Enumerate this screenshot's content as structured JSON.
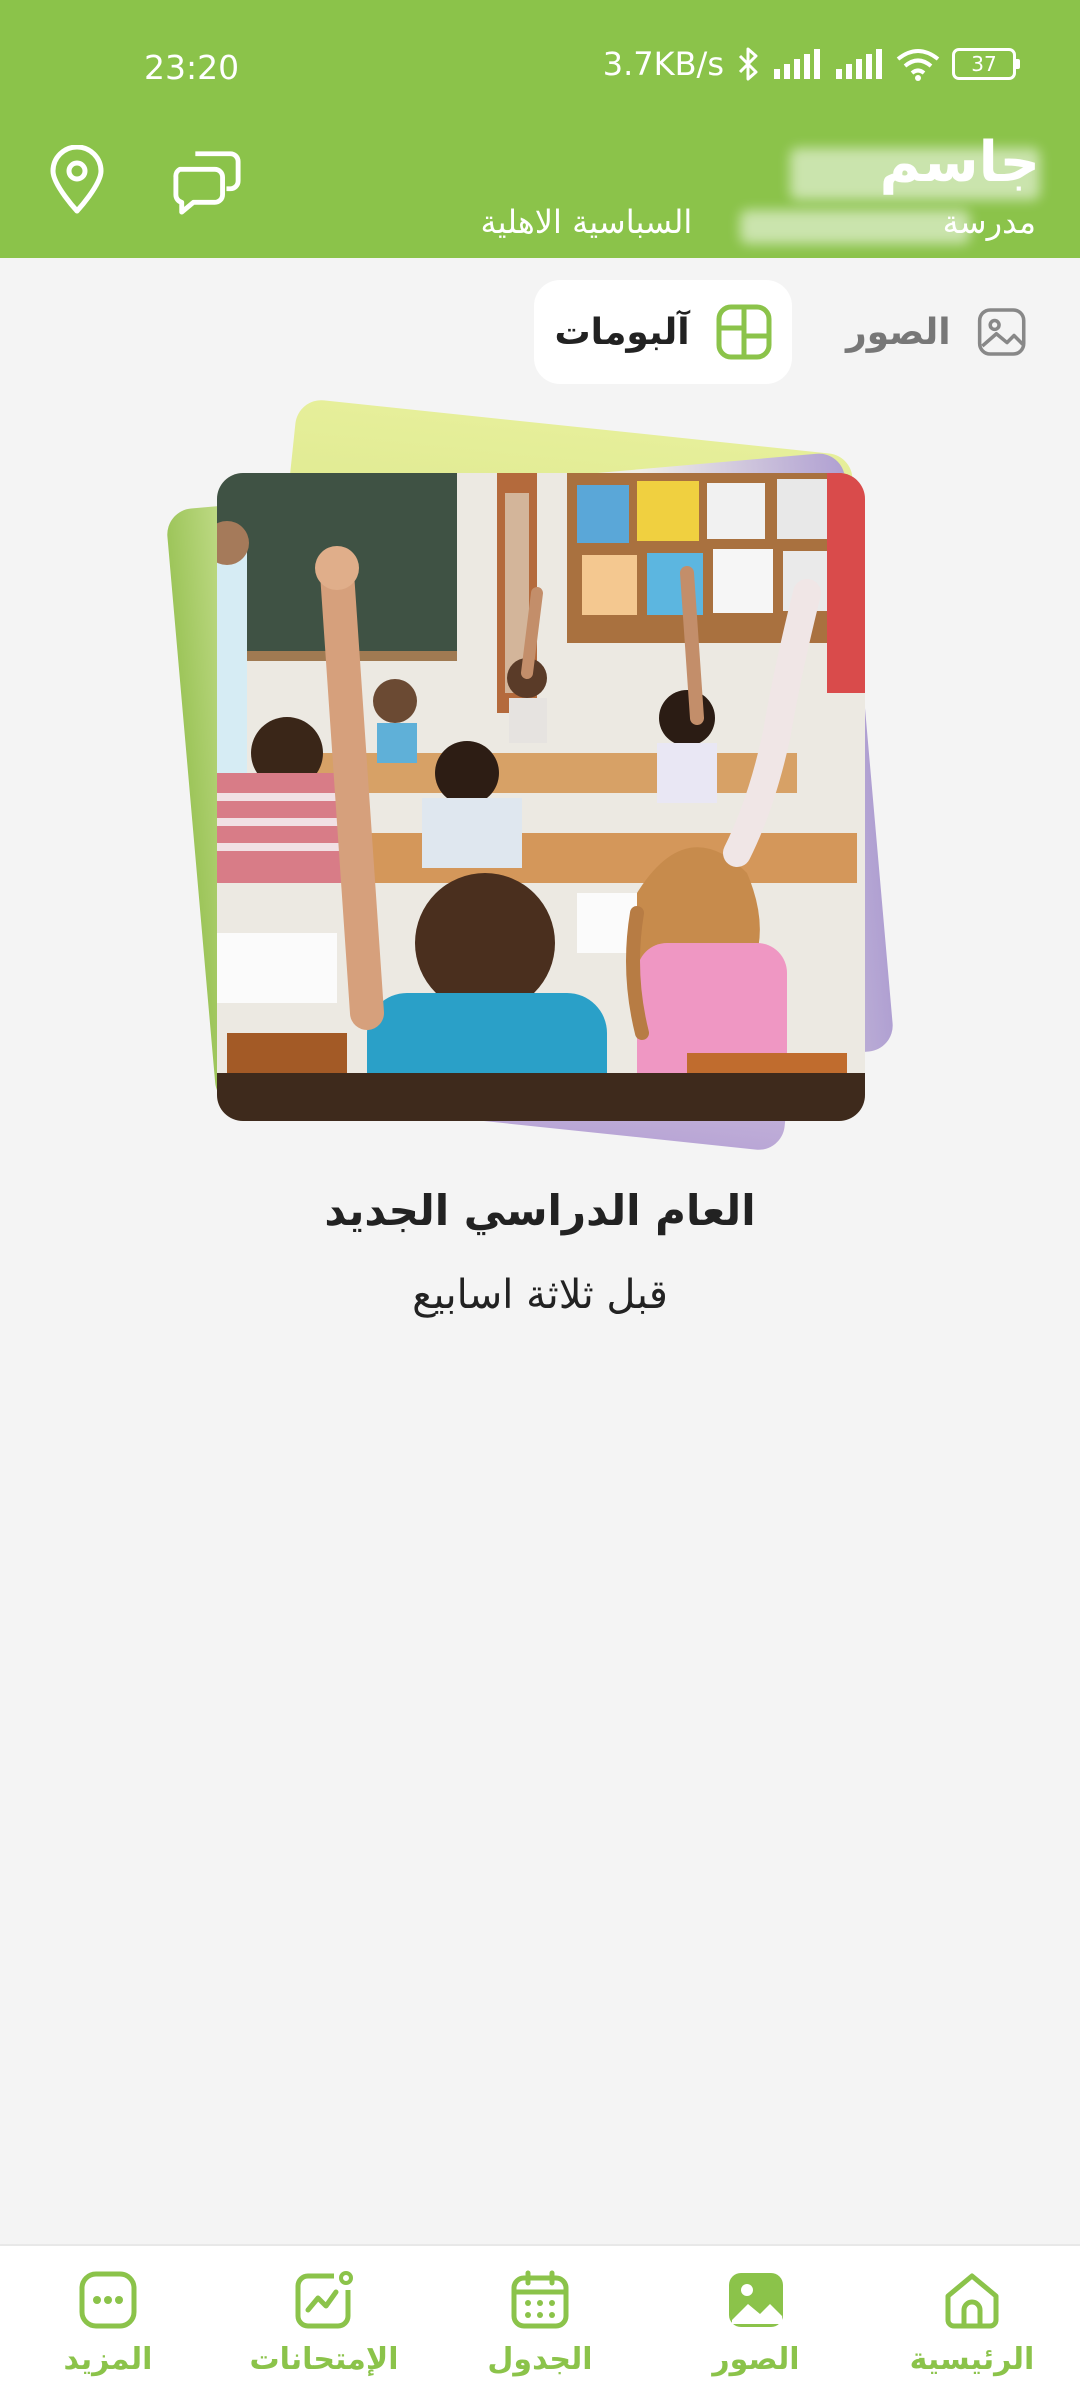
{
  "status": {
    "time": "23:20",
    "speed": "3.7KB/s",
    "battery": "37"
  },
  "header": {
    "user_name": "جاسم",
    "school_prefix": "مدرسة",
    "school_suffix": "السباسية الاهلية",
    "accent_color": "#8bc34a"
  },
  "tabs": [
    {
      "label": "الصور",
      "icon": "image-icon",
      "active": false
    },
    {
      "label": "آلبومات",
      "icon": "grid-icon",
      "active": true
    }
  ],
  "album": {
    "title": "العام الدراسي الجديد",
    "date": "قبل ثلاثة اسابيع"
  },
  "nav": [
    {
      "label": "الرئيسية",
      "icon": "home-icon"
    },
    {
      "label": "الصور",
      "icon": "photo-icon"
    },
    {
      "label": "الجدول",
      "icon": "calendar-icon"
    },
    {
      "label": "الإمتحانات",
      "icon": "chart-icon"
    },
    {
      "label": "المزيد",
      "icon": "more-icon"
    }
  ]
}
